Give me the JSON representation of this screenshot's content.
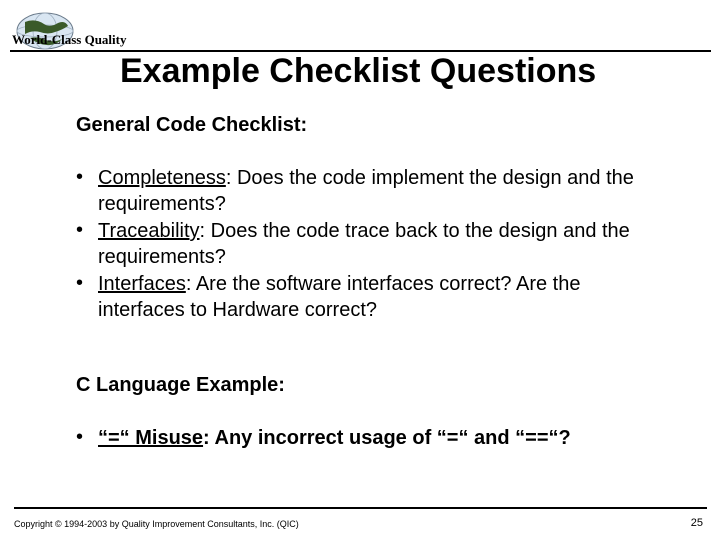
{
  "header": {
    "brand": "World-Class Quality"
  },
  "title": "Example Checklist Questions",
  "section1": {
    "heading": "General Code Checklist:",
    "items": [
      {
        "label": "Completeness",
        "text": ":  Does the code implement the design and the requirements?"
      },
      {
        "label": "Traceability",
        "text": ":  Does the code trace back to the design and the requirements?"
      },
      {
        "label": "Interfaces",
        "text": ":  Are the software interfaces correct?  Are the interfaces to Hardware correct?"
      }
    ]
  },
  "section2": {
    "heading": "C Language Example:",
    "items": [
      {
        "label": "“=“ Misuse",
        "text": ":  Any incorrect usage of “=“ and “==“?"
      }
    ]
  },
  "footer": {
    "copyright": "Copyright © 1994-2003 by Quality Improvement Consultants, Inc. (QIC)",
    "page": "25"
  }
}
